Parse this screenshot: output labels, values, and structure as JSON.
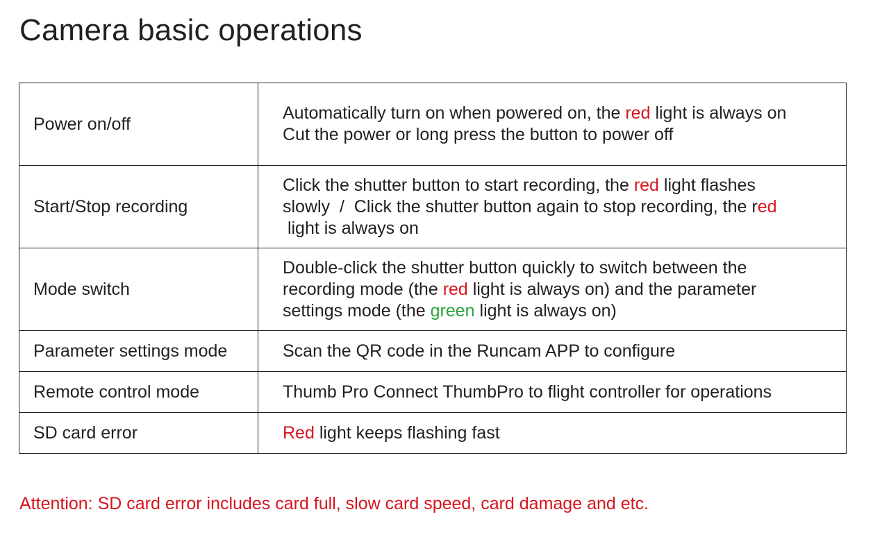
{
  "title": "Camera basic operations",
  "colors": {
    "text": "#231f20",
    "red": "#d7151f",
    "green": "#2aa33a"
  },
  "rows": [
    {
      "operation": "Power on/off",
      "desc": {
        "l1a": "Automatically turn on when powered on, the ",
        "l1b": "red",
        "l1c": " light is always on",
        "l2": "Cut the power or long press the button to power off"
      }
    },
    {
      "operation": "Start/Stop recording",
      "desc": {
        "l1a": "Click the shutter button to start recording, the ",
        "l1b": "red",
        "l1c": " light flashes",
        "l2a": "slowly  /  Click the shutter button again to stop recording, the r",
        "l2b": "ed",
        "l3": " light is always on"
      }
    },
    {
      "operation": "Mode switch",
      "desc": {
        "l1": "Double-click the shutter button quickly to switch between the",
        "l2a": "recording mode (the ",
        "l2b": "red",
        "l2c": " light is always on) and the parameter",
        "l3a": "settings mode (the ",
        "l3b": "green",
        "l3c": " light is always on)"
      }
    },
    {
      "operation": "Parameter settings mode",
      "desc": "Scan the QR code in the Runcam APP to configure"
    },
    {
      "operation": "Remote control mode",
      "desc": "Thumb Pro Connect ThumbPro to flight controller for operations"
    },
    {
      "operation": "SD card error",
      "desc": {
        "a": "Red",
        "b": " light keeps flashing fast"
      }
    }
  ],
  "attention": "Attention: SD card error includes card full, slow card speed, card damage and etc."
}
